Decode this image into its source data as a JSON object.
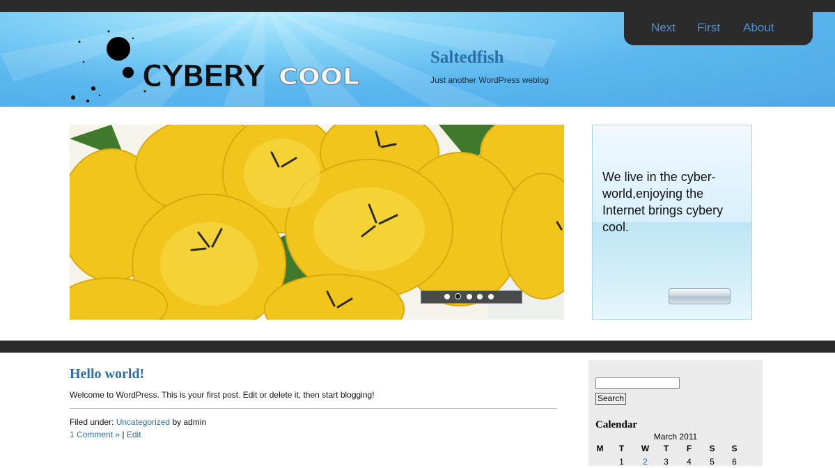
{
  "nav": {
    "items": [
      "Next",
      "First",
      "About"
    ]
  },
  "logo": {
    "word1": "CYBERY",
    "word2": "COOL"
  },
  "site": {
    "title": "Saltedfish",
    "description": "Just another WordPress weblog"
  },
  "slider": {
    "dot_count": 5,
    "active_dot": 2
  },
  "promo": {
    "text": "We live in the cyber-world,enjoying the Internet brings cybery cool."
  },
  "post": {
    "title": "Hello world!",
    "body": "Welcome to WordPress. This is your first post. Edit or delete it, then start blogging!",
    "filed_under_label": "Filed under:",
    "category": "Uncategorized",
    "by_label": "by admin",
    "comments_link": "1 Comment »",
    "separator": "|",
    "edit_link": "Edit"
  },
  "sidebar": {
    "search_button": "Search",
    "calendar_title": "Calendar",
    "calendar_caption": "March 2011",
    "weekdays": [
      "M",
      "T",
      "W",
      "T",
      "F",
      "S",
      "S"
    ],
    "first_week": [
      "",
      "1",
      "2",
      "3",
      "4",
      "5",
      "6"
    ],
    "linked_day": "2"
  },
  "colors": {
    "link": "#2c6ea8",
    "nav_link": "#4d8fcf",
    "dark_bar": "#2b2b2b",
    "header_blue": "#5cb8ef"
  }
}
